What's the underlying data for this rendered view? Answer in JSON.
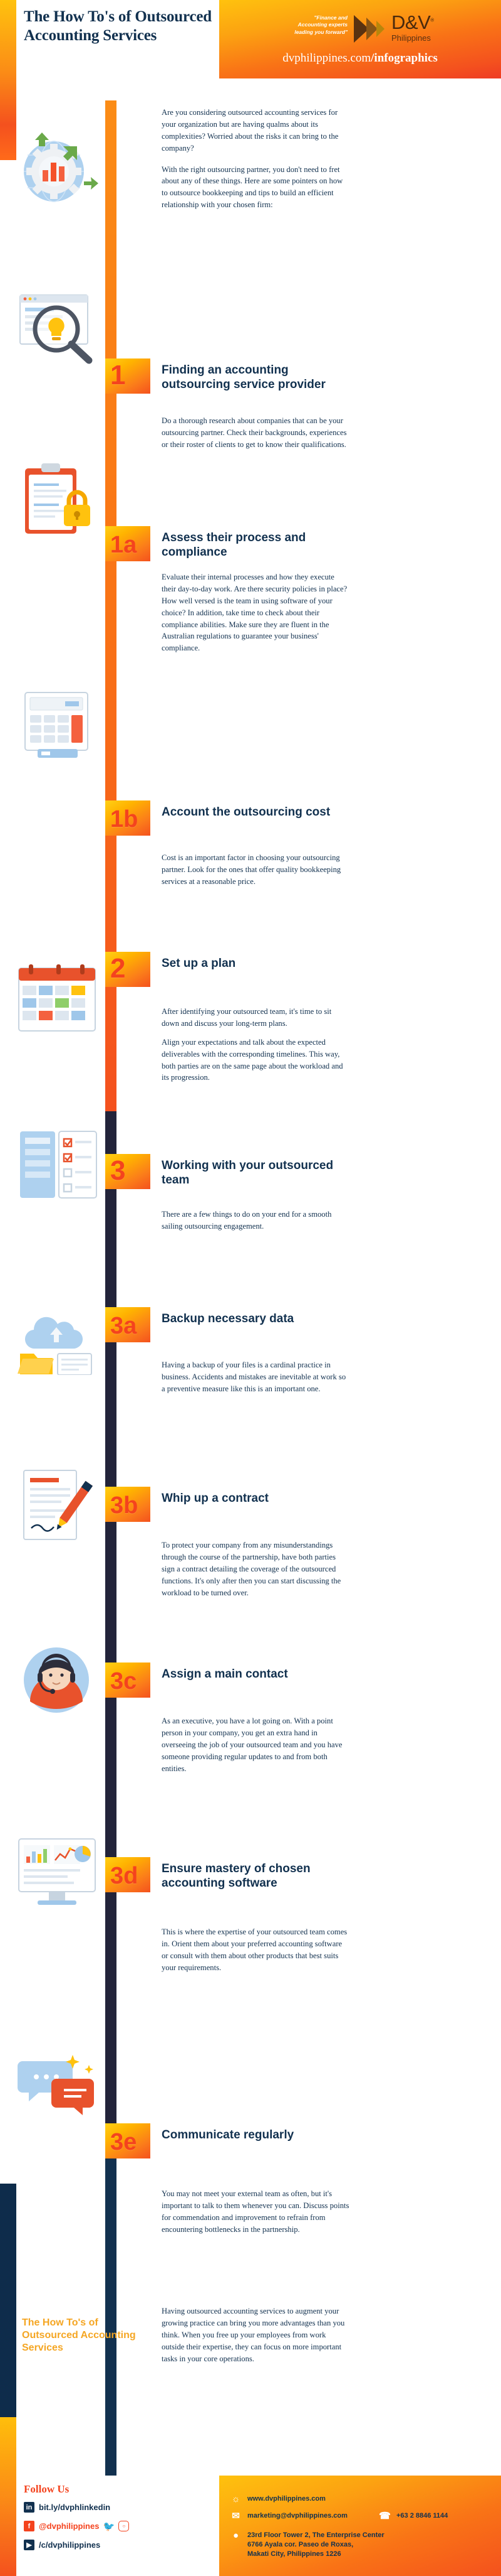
{
  "header": {
    "title": "The How To's of Outsourced Accounting Services",
    "tagline": "\"Finance and Accounting experts leading you forward\"",
    "logo_primary": "D&V",
    "logo_reg": "®",
    "logo_secondary": "Philippines",
    "url_plain": "dvphilippines.com",
    "url_bold": "/infographics"
  },
  "intro": {
    "p1": "Are you considering outsourced accounting services for your organization but are having qualms about its complexities? Worried about the risks it can bring to the company?",
    "p2": "With the right outsourcing partner, you don't need to fret about any of these things. Here are some pointers on how to outsource bookkeeping  and tips to build an efficient relationship with your chosen firm:"
  },
  "steps": [
    {
      "badge": "1",
      "title": "Finding an accounting outsourcing service provider",
      "body": [
        "Do a thorough research about companies that can be your outsourcing partner. Check their backgrounds, experiences or their roster of clients to get to know their qualifications."
      ],
      "icon": "magnifier-lightbulb-icon"
    },
    {
      "badge": "1a",
      "title": "Assess their process and compliance",
      "body": [
        "Evaluate their internal processes and how they execute their day-to-day work. Are there security policies in place? How well versed is the team in using software of your choice? In addition, take time to check about their compliance abilities. Make sure they are fluent in the Australian regulations to guarantee your business'  compliance."
      ],
      "icon": "clipboard-lock-icon"
    },
    {
      "badge": "1b",
      "title": "Account the outsourcing cost",
      "body": [
        "Cost is an important factor in choosing your outsourcing partner. Look for the ones that offer quality bookkeeping services at a reasonable price."
      ],
      "icon": "calculator-icon"
    },
    {
      "badge": "2",
      "title": "Set up a plan",
      "body": [
        "After identifying your outsourced team, it's time to sit down and discuss your long-term plans.",
        "Align your expectations and talk about the expected deliverables with the corresponding timelines. This way, both parties are on the same page about the workload and its progression."
      ],
      "icon": "calendar-icon"
    },
    {
      "badge": "3",
      "title": "Working with your outsourced team",
      "body": [
        "There are a few things to do on your end for a smooth sailing outsourcing engagement."
      ],
      "icon": "checklist-board-icon"
    },
    {
      "badge": "3a",
      "title": "Backup necessary data",
      "body": [
        "Having a backup of your files is a cardinal practice in business. Accidents and mistakes are inevitable at work so a preventive measure like this is an important one."
      ],
      "icon": "cloud-backup-icon"
    },
    {
      "badge": "3b",
      "title": "Whip up a contract",
      "body": [
        "To protect your company from any misunderstandings through the course of the partnership, have both parties sign a contract detailing the coverage of the outsourced functions. It's only after then you can start discussing the workload to be turned over."
      ],
      "icon": "contract-pen-icon"
    },
    {
      "badge": "3c",
      "title": "Assign a main contact",
      "body": [
        "As an executive, you have a lot going on. With a point person in your company, you get an extra hand in overseeing the job of your outsourced team and you have someone providing regular updates to and from both entities."
      ],
      "icon": "person-headset-icon"
    },
    {
      "badge": "3d",
      "title": "Ensure mastery of chosen accounting software",
      "body": [
        "This is where the expertise of your outsourced team comes in. Orient them about your preferred accounting software or consult with them about other products that best suits your requirements."
      ],
      "icon": "dashboard-monitor-icon"
    },
    {
      "badge": "3e",
      "title": "Communicate regularly",
      "body": [
        "You may not meet your external team as often, but it's important to talk to them whenever you can. Discuss points for commendation and improvement to refrain from encountering bottlenecks in the partnership."
      ],
      "icon": "chat-bubbles-icon"
    }
  ],
  "closing": {
    "title": "The How To's of Outsourced Accounting Services",
    "paragraph": "Having outsourced accounting services to augment your growing practice can bring you more advantages than you think. When you free up your employees from work outside their expertise, they can focus on more important tasks in your core operations."
  },
  "footer": {
    "follow_heading": "Follow Us",
    "social": [
      {
        "icon": "linkedin-icon",
        "glyph": "in",
        "label": "bit.ly/dvphlinkedin"
      },
      {
        "icon": "facebook-icon",
        "glyph": "f",
        "label": "@dvphilippines"
      },
      {
        "icon": "youtube-icon",
        "glyph": "▶",
        "label": "/c/dvphilippines"
      }
    ],
    "twitter_icon": "twitter-icon",
    "instagram_icon": "instagram-icon",
    "website": "www.dvphilippines.com",
    "email": "marketing@dvphilippines.com",
    "phone": "+63 2 8846 1144",
    "address_line1": "23rd Floor Tower 2, The Enterprise Center",
    "address_line2": "6766 Ayala cor. Paseo de Roxas,",
    "address_line3": "Makati City, Philippines 1226"
  },
  "colors": {
    "navy": "#12314f",
    "orange": "#f4511e",
    "amber": "#ffc20e",
    "gold": "#f5a623"
  }
}
